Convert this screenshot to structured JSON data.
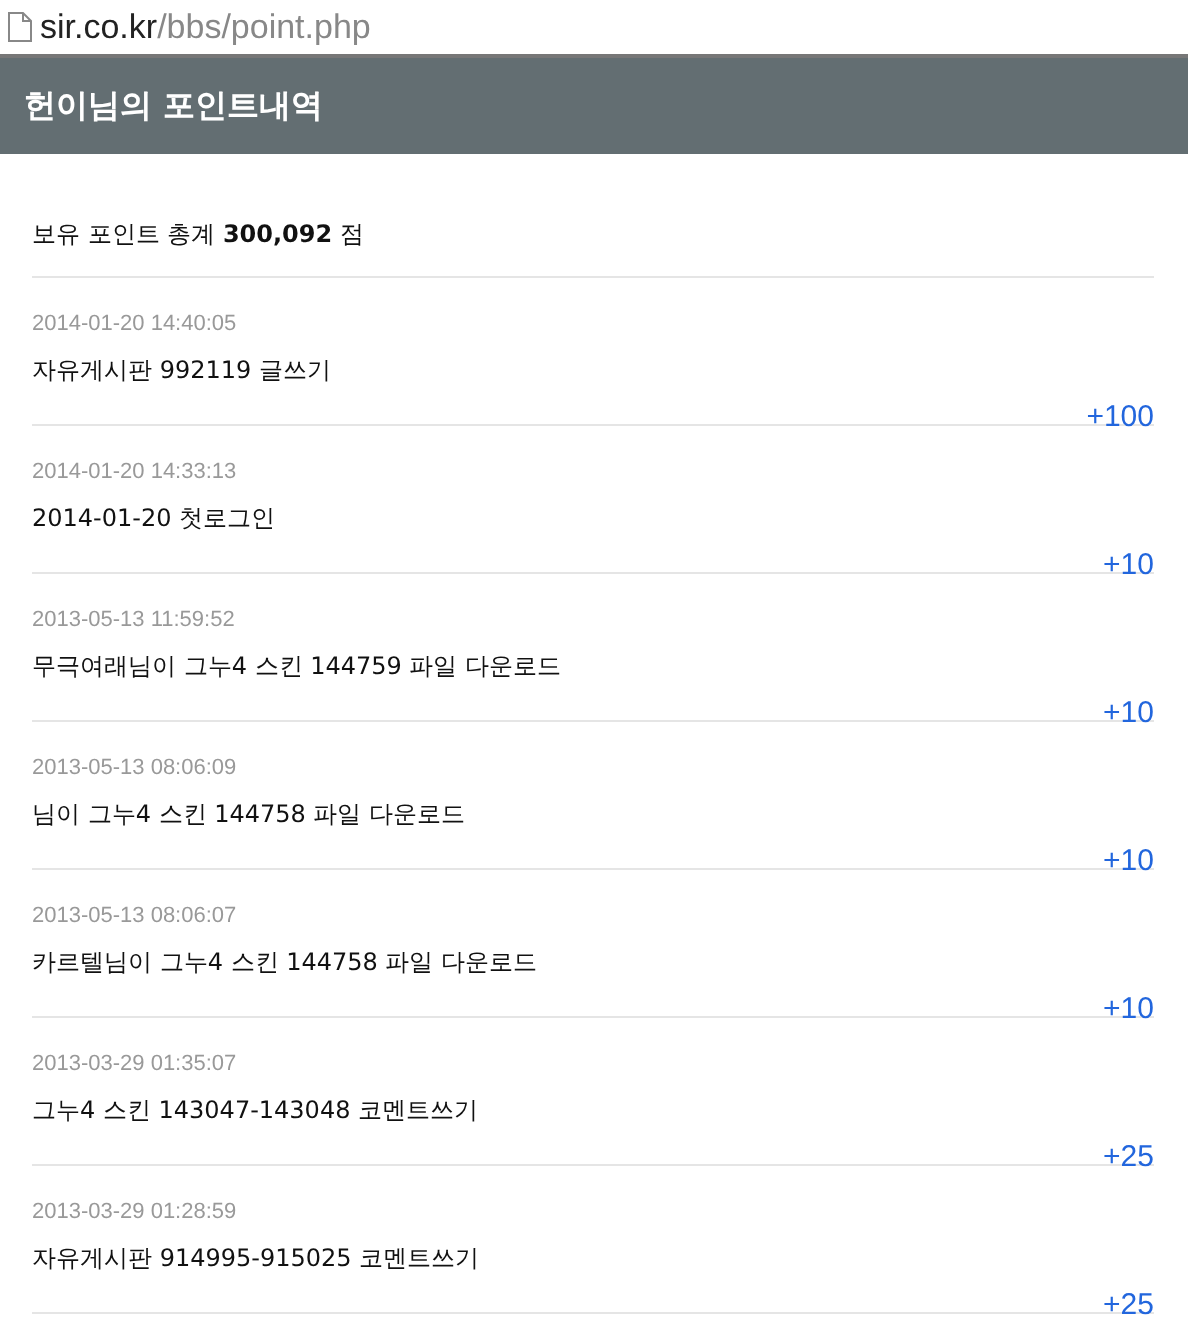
{
  "address_bar": {
    "domain": "sir.co.kr",
    "path": "/bbs/point.php"
  },
  "header": {
    "title": "헌이님의 포인트내역"
  },
  "summary": "보유 포인트 총계 **300,092** 점",
  "entries": [
    {
      "datetime": "2014-01-20 14:40:05",
      "description": "자유게시판 992119 글쓰기",
      "points": "+100"
    },
    {
      "datetime": "2014-01-20 14:33:13",
      "description": "2014-01-20 첫로그인",
      "points": "+10"
    },
    {
      "datetime": "2013-05-13 11:59:52",
      "description": "무극여래님이 그누4 스킨 144759 파일 다운로드",
      "points": "+10"
    },
    {
      "datetime": "2013-05-13 08:06:09",
      "description": "님이 그누4 스킨 144758 파일 다운로드",
      "points": "+10"
    },
    {
      "datetime": "2013-05-13 08:06:07",
      "description": "카르텔님이 그누4 스킨 144758 파일 다운로드",
      "points": "+10"
    },
    {
      "datetime": "2013-03-29 01:35:07",
      "description": "그누4 스킨 143047-143048 코멘트쓰기",
      "points": "+25"
    },
    {
      "datetime": "2013-03-29 01:28:59",
      "description": "자유게시판 914995-915025 코멘트쓰기",
      "points": "+25"
    }
  ]
}
